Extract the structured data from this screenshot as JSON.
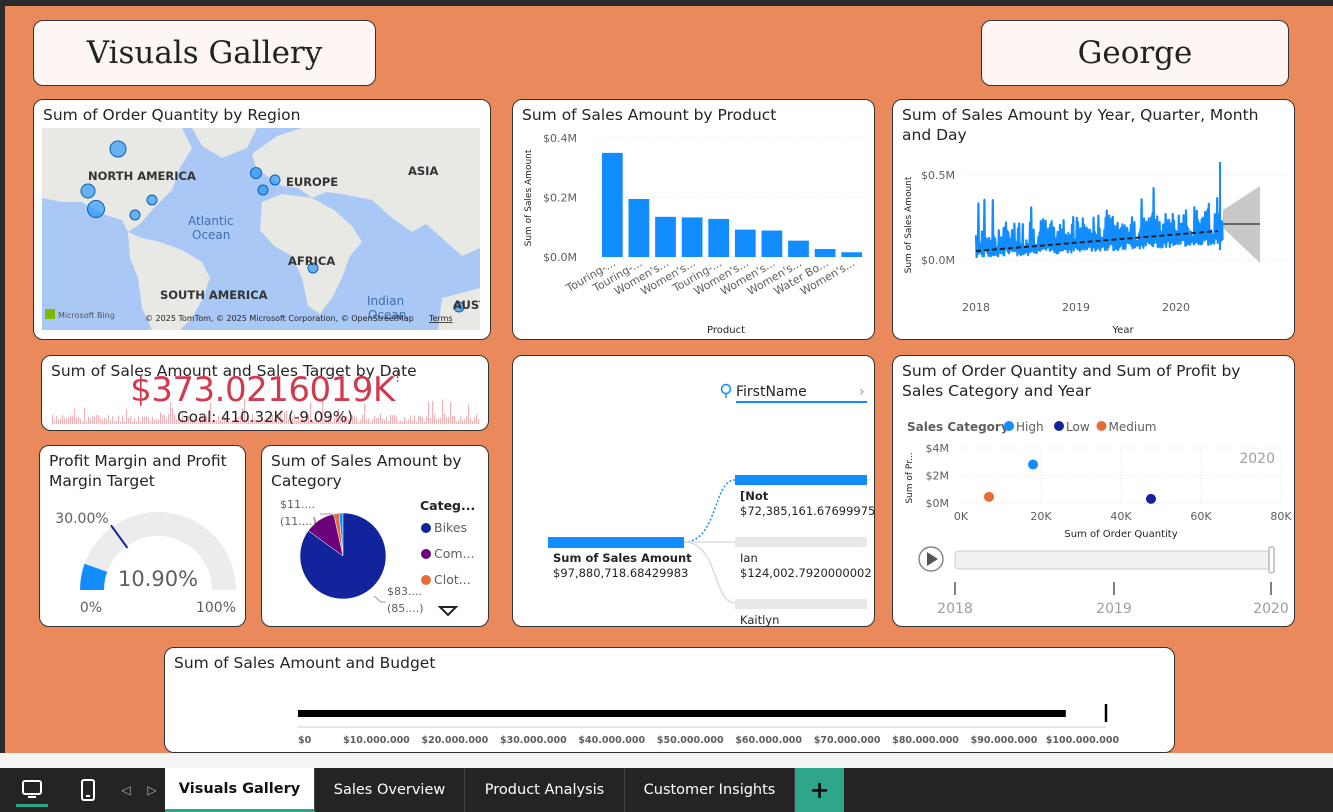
{
  "page": {
    "title": "Visuals Gallery",
    "user_name": "George"
  },
  "map_card": {
    "title": "Sum of Order Quantity by Region",
    "labels": {
      "north_america": "NORTH AMERICA",
      "europe": "EUROPE",
      "asia": "ASIA",
      "africa": "AFRICA",
      "south_america": "SOUTH AMERICA",
      "atlantic": "Atlantic",
      "ocean": "Ocean",
      "indian": "Indian",
      "ocean2": "Ocean",
      "aust": "AUST"
    },
    "attribution": "© 2025 TomTom, © 2025 Microsoft Corporation, © OpenStreetMap",
    "terms": "Terms",
    "bing": "Microsoft Bing"
  },
  "product_card": {
    "title": "Sum of Sales Amount by Product",
    "chart_data": {
      "type": "bar",
      "title": "Sum of Sales Amount by Product",
      "xlabel": "Product",
      "ylabel": "Sum of Sales Amount",
      "yticks": [
        "$0.4M",
        "$0.2M",
        "$0.0M"
      ],
      "ylim": [
        0,
        0.4
      ],
      "categories": [
        "Touring-...",
        "Touring-...",
        "Women's...",
        "Women's...",
        "Touring-...",
        "Women's...",
        "Women's...",
        "Women's...",
        "Water Bo...",
        "Women's..."
      ],
      "values": [
        0.35,
        0.195,
        0.135,
        0.133,
        0.128,
        0.092,
        0.089,
        0.055,
        0.027,
        0.016
      ],
      "color": "#118dff"
    }
  },
  "timeseries_card": {
    "title": "Sum of Sales Amount by Year, Quarter, Month and Day",
    "chart_data": {
      "type": "line",
      "xlabel": "Year",
      "ylabel": "Sum of Sales Amount",
      "yticks": [
        "$0.5M",
        "$0.0M"
      ],
      "xticks": [
        "2018",
        "2019",
        "2020"
      ],
      "color": "#118dff",
      "trend_color": "#222222",
      "forecast_color": "#c8c8c8"
    }
  },
  "kpi_card": {
    "title": "Sum of Sales Amount and Sales Target by Date",
    "value": "$373.0216019K",
    "indicator": "!",
    "goal": "Goal: 410.32K (-9.09%)",
    "color": "#d13b4f"
  },
  "gauge_card": {
    "title": "Profit Margin and Profit Margin Target",
    "chart_data": {
      "type": "gauge",
      "value_label": "10.90%",
      "value": 0.109,
      "target_label": "30.00%",
      "target": 0.3,
      "min_label": "0%",
      "max_label": "100%",
      "fill_color": "#118dff",
      "track_color": "#ececec",
      "target_color": "#12239e"
    }
  },
  "pie_card": {
    "title": "Sum of Sales Amount by Category",
    "legend_title": "Categ...",
    "legend": [
      {
        "label": "Bikes",
        "color": "#12239e"
      },
      {
        "label": "Com...",
        "color": "#6b007b"
      },
      {
        "label": "Clot...",
        "color": "#e66c37"
      }
    ],
    "small_label_1": "$11....",
    "small_label_2": "(11....)",
    "big_label_1": "$83....",
    "big_label_2": "(85....)",
    "chart_data": {
      "type": "pie",
      "slices": [
        {
          "name": "Bikes",
          "value": 0.85,
          "color": "#12239e"
        },
        {
          "name": "Com...",
          "value": 0.115,
          "color": "#6b007b"
        },
        {
          "name": "Clot...",
          "value": 0.02,
          "color": "#e66c37"
        },
        {
          "name": "other",
          "value": 0.015,
          "color": "#118dff"
        }
      ]
    }
  },
  "decomp_card": {
    "field": "FirstName",
    "root_label": "Sum of Sales Amount",
    "root_value": "$97,880,718.68429983",
    "nodes": [
      {
        "label": "[Not",
        "value": "$72,385,161.67699975",
        "fill": 1.0
      },
      {
        "label": "Ian",
        "value": "$124,002.7920000002",
        "fill": 0.0
      },
      {
        "label": "Kaitlyn",
        "value": "",
        "fill": 0.0
      }
    ]
  },
  "scatter_card": {
    "title": "Sum of Order Quantity and Sum of Profit by Sales Category and Year",
    "legend_title": "Sales Category",
    "legend": [
      {
        "label": "High",
        "color": "#118dff"
      },
      {
        "label": "Low",
        "color": "#12239e"
      },
      {
        "label": "Medium",
        "color": "#e66c37"
      }
    ],
    "year_label": "2020",
    "play_axis": [
      "2018",
      "2019",
      "2020"
    ],
    "chart_data": {
      "type": "scatter",
      "xlabel": "Sum of Order Quantity",
      "ylabel": "Sum of Pr...",
      "xticks": [
        "0K",
        "20K",
        "40K",
        "60K",
        "80K"
      ],
      "yticks": [
        "$4M",
        "$2M",
        "$0M"
      ],
      "xlim": [
        0,
        80000
      ],
      "ylim": [
        0,
        4
      ],
      "points": [
        {
          "series": "High",
          "x": 18000,
          "y": 2.8
        },
        {
          "series": "Low",
          "x": 47500,
          "y": 0.3
        },
        {
          "series": "Medium",
          "x": 7000,
          "y": 0.45
        }
      ]
    }
  },
  "bullet_card": {
    "title": "Sum of Sales Amount and Budget",
    "chart_data": {
      "type": "bar",
      "value": 97880718,
      "target": 103000000,
      "xlim": [
        0,
        103000000
      ],
      "xticks": [
        "$0",
        "$10.000.000",
        "$20.000.000",
        "$30.000.000",
        "$40.000.000",
        "$50.000.000",
        "$60.000.000",
        "$70.000.000",
        "$80.000.000",
        "$90.000.000",
        "$100.000.000"
      ]
    }
  },
  "tabs": [
    {
      "label": "Visuals Gallery",
      "active": true
    },
    {
      "label": "Sales Overview",
      "active": false
    },
    {
      "label": "Product Analysis",
      "active": false
    },
    {
      "label": "Customer Insights",
      "active": false
    }
  ],
  "add_tab": "+",
  "nav": {
    "prev": "◁",
    "next": "▷"
  }
}
